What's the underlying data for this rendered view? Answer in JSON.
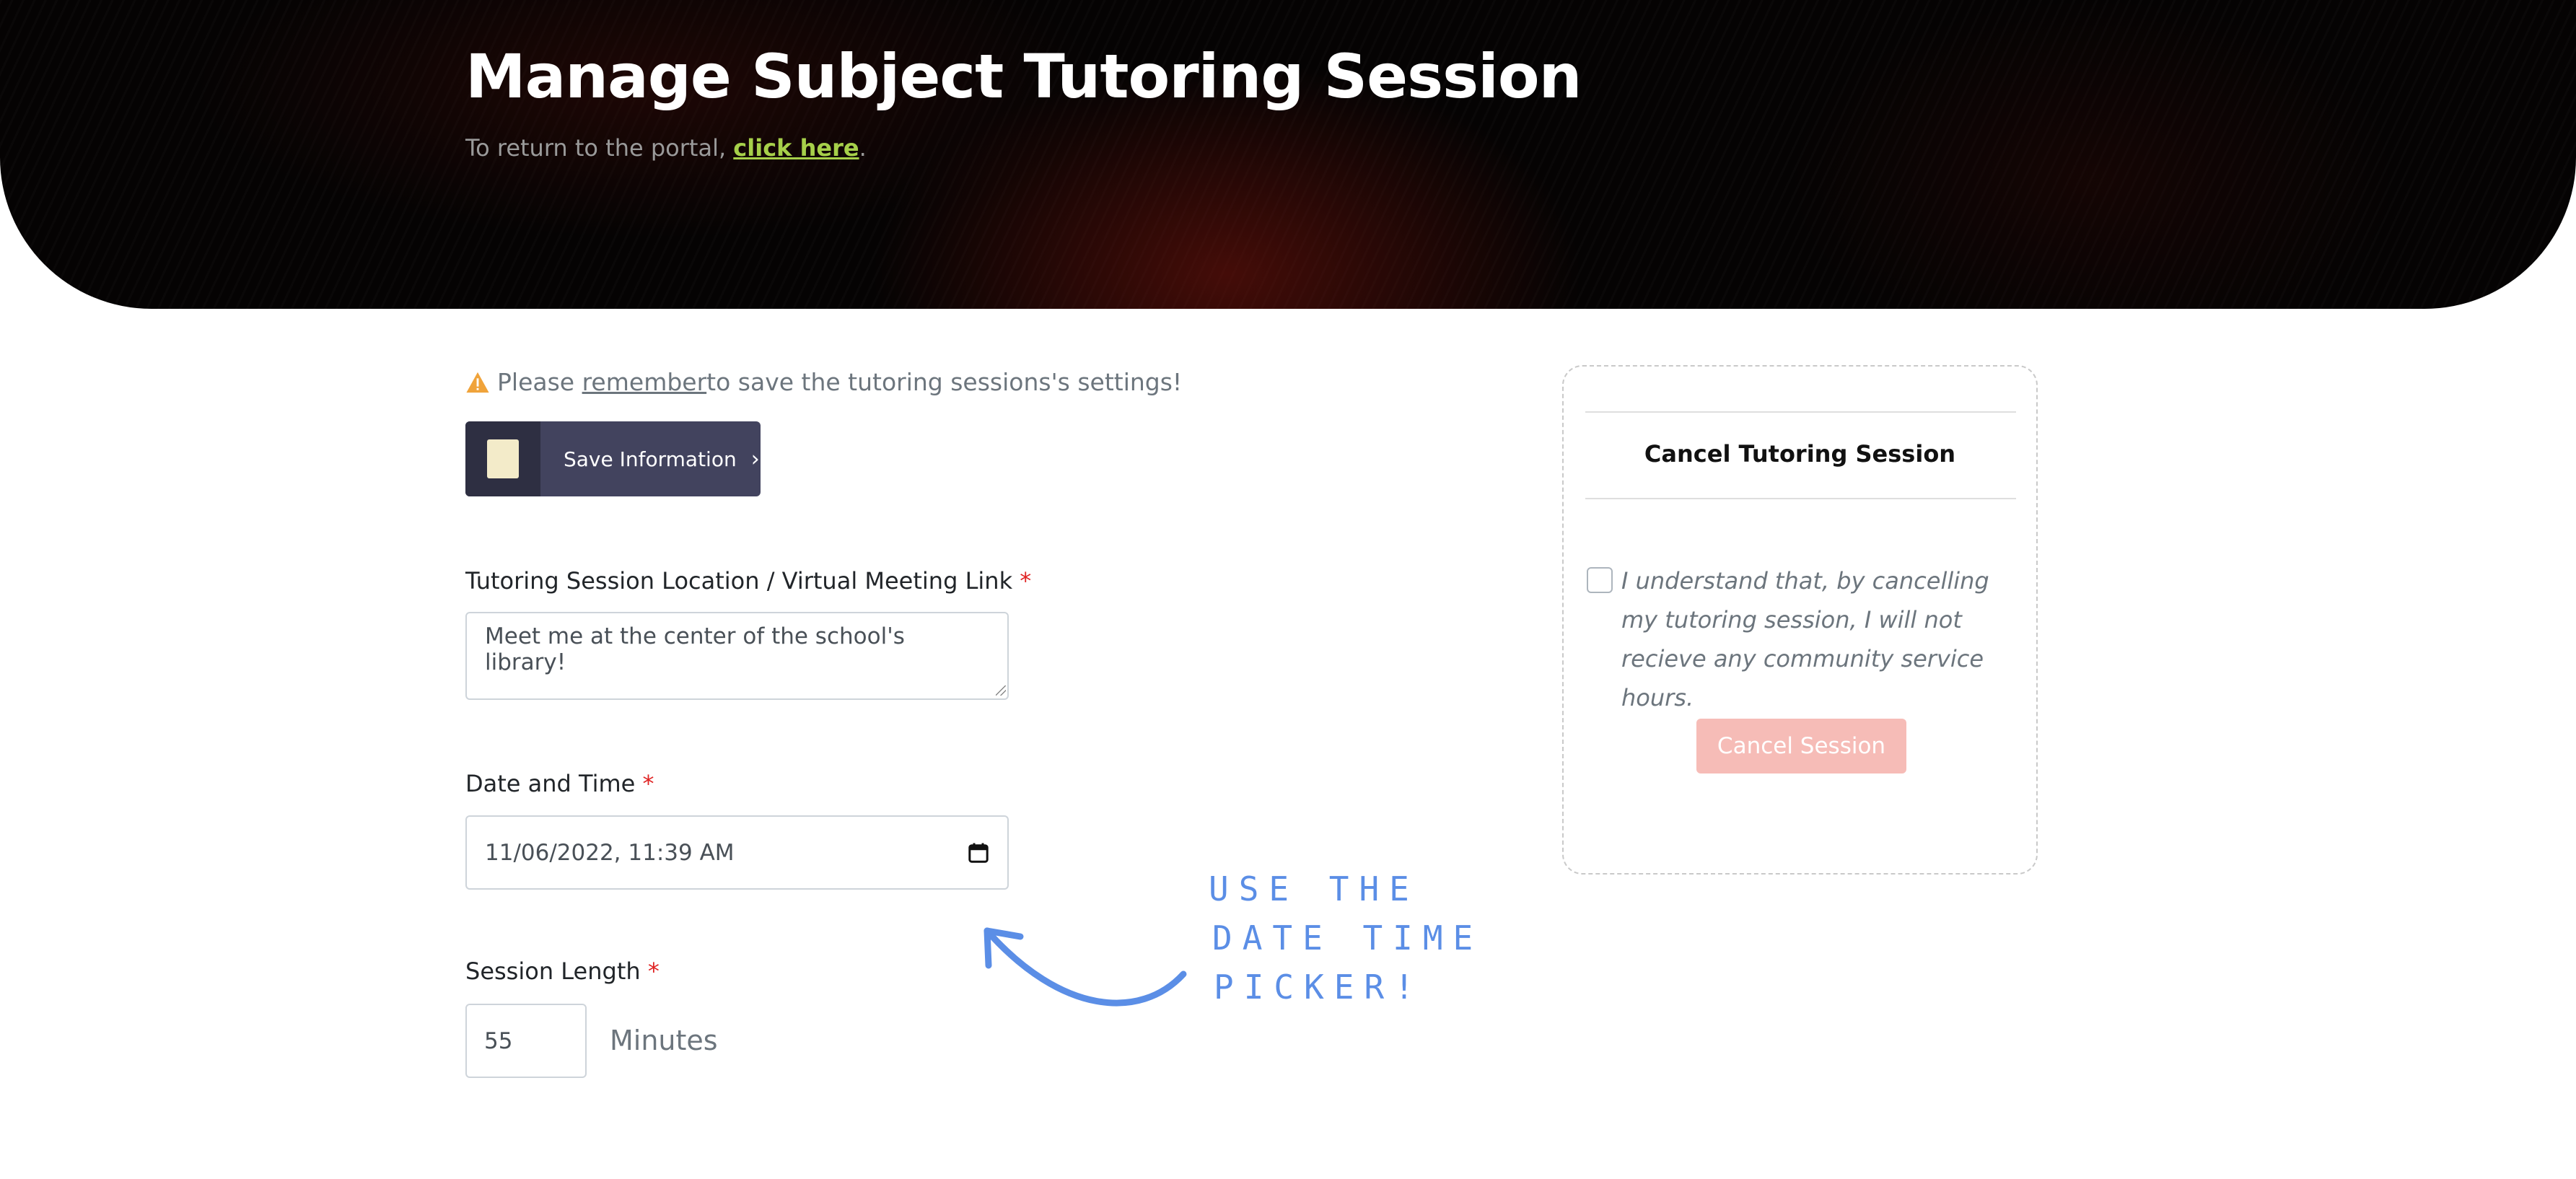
{
  "header": {
    "title": "Manage Subject Tutoring Session",
    "subtitle_prefix": "To return to the portal, ",
    "subtitle_link": "click here",
    "subtitle_suffix": "."
  },
  "notice": {
    "prefix": "Please ",
    "emphasis": "remember",
    "suffix": " to save the tutoring sessions's settings!",
    "icon": "warning-icon",
    "icon_color": "#f0a33a"
  },
  "save_button": {
    "label": "Save Information",
    "chevron": "›",
    "icon": "document-icon"
  },
  "fields": {
    "location": {
      "label": "Tutoring Session Location / Virtual Meeting Link",
      "required_mark": "*",
      "value": "Meet me at the center of the school's library!"
    },
    "datetime": {
      "label": "Date and Time",
      "required_mark": "*",
      "value": "11/06/2022, 11:39 AM",
      "icon": "calendar-icon"
    },
    "length": {
      "label": "Session Length",
      "required_mark": "*",
      "value": "55",
      "unit": "Minutes"
    }
  },
  "annotation": {
    "lines": [
      "USE THE",
      "DATE TIME",
      "PICKER!"
    ],
    "color": "#5b8ee6"
  },
  "cancel_card": {
    "title": "Cancel Tutoring Session",
    "acknowledgement": "I understand that, by cancelling my tutoring session, I will not recieve any community service hours.",
    "button_label": "Cancel Session",
    "button_color": "#f6bcb7"
  },
  "colors": {
    "link": "#a6d04a",
    "required": "#e02424",
    "save_button_bg": "#42435e"
  }
}
